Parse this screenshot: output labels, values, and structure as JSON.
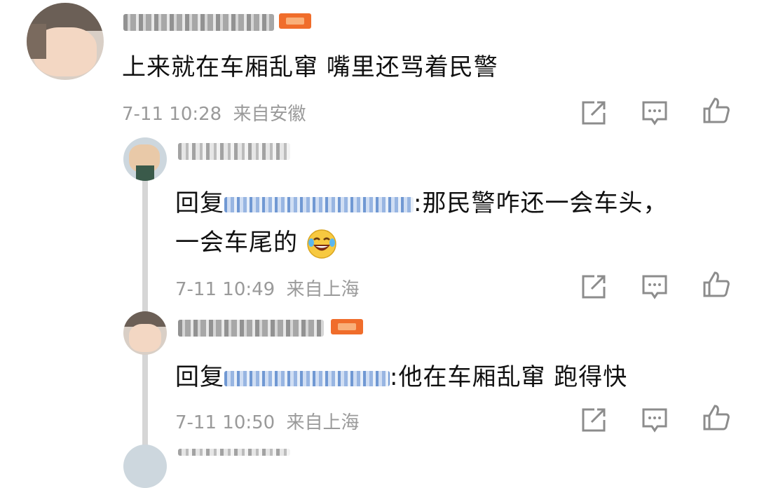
{
  "comments": [
    {
      "text": "上来就在车厢乱窜 嘴里还骂着民警",
      "time": "7-11 10:28",
      "location": "来自安徽"
    }
  ],
  "replies": [
    {
      "prefix": "回复",
      "text_line1": ":那民警咋还一会车头，",
      "text_line2": "一会车尾的",
      "emoji": "laugh-cry-emoji",
      "time": "7-11 10:49",
      "location": "来自上海"
    },
    {
      "prefix": "回复",
      "text_line1": ":他在车厢乱窜 跑得快",
      "time": "7-11 10:50",
      "location": "来自上海"
    }
  ],
  "icons": [
    "share-icon",
    "comment-icon",
    "like-icon"
  ],
  "colors": {
    "meta": "#9a9a9a",
    "badge": "#f06d2b",
    "mention": "#4d7fc8",
    "thread": "#d6d6d6"
  }
}
